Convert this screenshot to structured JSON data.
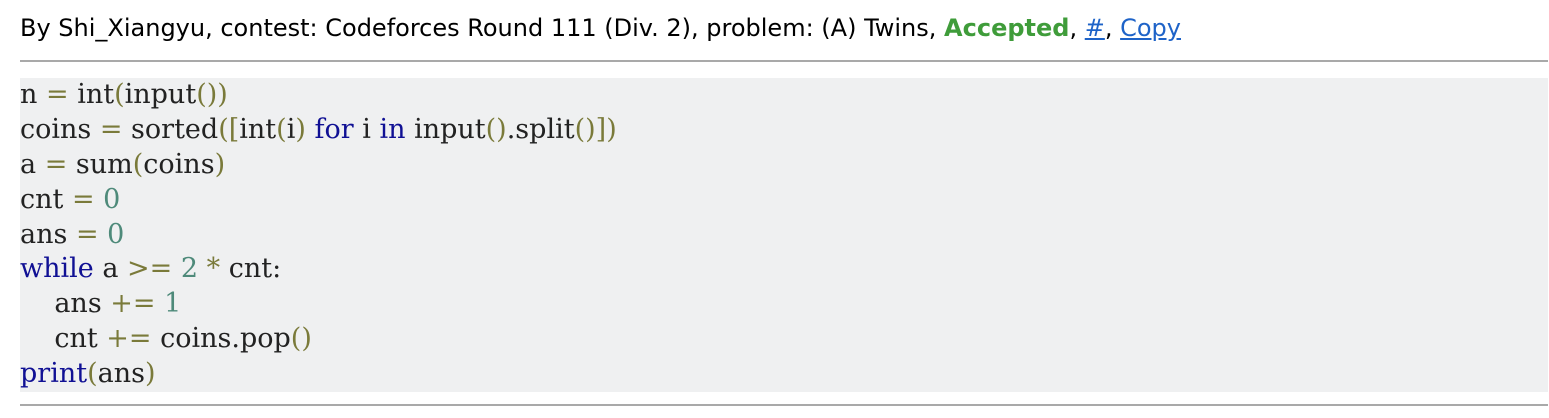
{
  "header": {
    "prefix": "By ",
    "author": "Shi_Xiangyu",
    "contest_prefix": ", contest: ",
    "contest": "Codeforces Round 111 (Div. 2)",
    "problem_prefix": ", problem: ",
    "problem": "(A) Twins",
    "sep1": ", ",
    "verdict": "Accepted",
    "sep2": ", ",
    "hash_link": "#",
    "sep3": ", ",
    "copy_link": "Copy"
  },
  "colors": {
    "verdict": "#3f9c3a",
    "link": "#1e63c8",
    "keyword": "#101094",
    "number": "#4e8a7a",
    "code_background": "#eff0f1"
  },
  "code": {
    "language": "python",
    "lines": [
      "n = int(input())",
      "coins = sorted([int(i) for i in input().split()])",
      "a = sum(coins)",
      "cnt = 0",
      "ans = 0",
      "while a >= 2 * cnt:",
      "    ans += 1",
      "    cnt += coins.pop()",
      "print(ans)"
    ]
  }
}
